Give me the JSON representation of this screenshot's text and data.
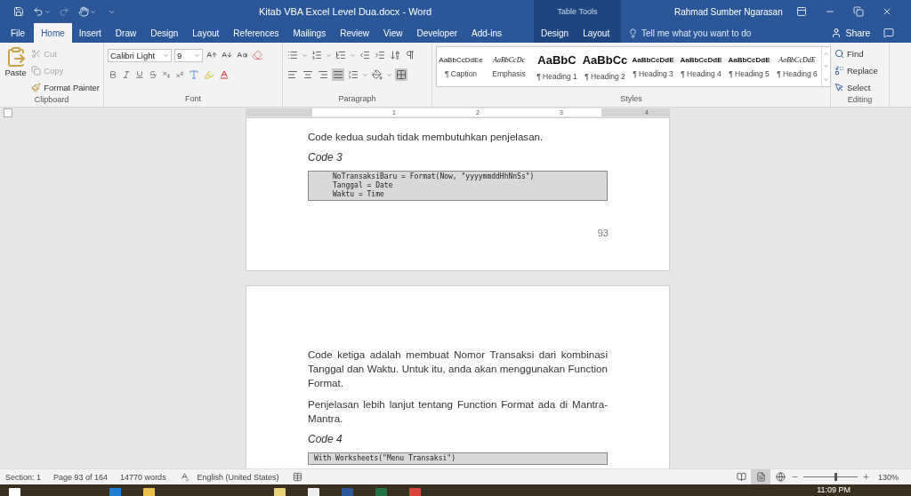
{
  "window": {
    "title": "Kitab VBA Excel Level Dua.docx  -  Word",
    "contextual_group": "Table Tools",
    "account": "Rahmad Sumber Ngarasan"
  },
  "tabs": [
    {
      "label": "File",
      "selected": false
    },
    {
      "label": "Home",
      "selected": true
    },
    {
      "label": "Insert",
      "selected": false
    },
    {
      "label": "Draw",
      "selected": false
    },
    {
      "label": "Design",
      "selected": false
    },
    {
      "label": "Layout",
      "selected": false
    },
    {
      "label": "References",
      "selected": false
    },
    {
      "label": "Mailings",
      "selected": false
    },
    {
      "label": "Review",
      "selected": false
    },
    {
      "label": "View",
      "selected": false
    },
    {
      "label": "Developer",
      "selected": false
    },
    {
      "label": "Add-ins",
      "selected": false
    }
  ],
  "contextual_tabs": [
    {
      "label": "Design",
      "selected": false
    },
    {
      "label": "Layout",
      "selected": false
    }
  ],
  "tell_me": {
    "placeholder": "Tell me what you want to do"
  },
  "share": "Share",
  "clipboard": {
    "paste": "Paste",
    "actions": [
      {
        "label": "Cut",
        "disabled": true
      },
      {
        "label": "Copy",
        "disabled": true
      },
      {
        "label": "Format Painter",
        "disabled": false
      }
    ],
    "label": "Clipboard"
  },
  "font": {
    "name": "Calibri Light",
    "size": "9",
    "label": "Font"
  },
  "paragraph": {
    "label": "Paragraph"
  },
  "styles": {
    "label": "Styles",
    "items": [
      {
        "preview": "AaBbCcDdEe",
        "name": "¶ Caption",
        "kind": "small"
      },
      {
        "preview": "AaBbCcDc",
        "name": "Emphasis",
        "kind": "italic"
      },
      {
        "preview": "AaBbC",
        "name": "¶ Heading 1",
        "kind": "large"
      },
      {
        "preview": "AaBbCc",
        "name": "¶ Heading 2",
        "kind": "large"
      },
      {
        "preview": "AaBbCcDdE",
        "name": "¶ Heading 3",
        "kind": "bold"
      },
      {
        "preview": "AaBbCcDdE",
        "name": "¶ Heading 4",
        "kind": "bold"
      },
      {
        "preview": "AaBbCcDdE",
        "name": "¶ Heading 5",
        "kind": "bold"
      },
      {
        "preview": "AaBbCcDdE",
        "name": "¶ Heading 6",
        "kind": "italic"
      }
    ]
  },
  "editing": {
    "label": "Editing",
    "items": [
      "Find",
      "Replace",
      "Select"
    ]
  },
  "ruler": [
    "1",
    "2",
    "3",
    "4"
  ],
  "pages": [
    {
      "blocks": [
        {
          "kind": "para",
          "text": "Code kedua sudah tidak membutuhkan penjelasan."
        },
        {
          "kind": "caption",
          "text": "Code 3"
        },
        {
          "kind": "code",
          "lines": [
            "NoTransaksiBaru = Format(Now, \"yyyymmddHhNnSs\")",
            "Tanggal = Date",
            "Waktu = Time"
          ]
        }
      ],
      "page_number": "93"
    },
    {
      "blocks": [
        {
          "kind": "para",
          "text": "Code ketiga adalah membuat Nomor Transaksi dari kombinasi Tanggal dan Waktu. Untuk itu, anda akan menggunakan Function Format."
        },
        {
          "kind": "para",
          "text": "Penjelasan lebih lanjut tentang Function Format ada di Mantra-Mantra."
        },
        {
          "kind": "caption",
          "text": "Code 4"
        },
        {
          "kind": "code",
          "lines": [
            "With Worksheets(\"Menu Transaksi\")"
          ]
        }
      ]
    }
  ],
  "status_bar": {
    "section": "Section: 1",
    "page": "Page 93 of 164",
    "words": "14770 words",
    "language": "English (United States)",
    "views": [
      {
        "kind": "read",
        "selected": false
      },
      {
        "kind": "print",
        "selected": true
      },
      {
        "kind": "web",
        "selected": false
      }
    ],
    "zoom": {
      "level": 0.59,
      "reading": "130%"
    }
  },
  "taskbar": {
    "time": "11:09 PM"
  }
}
